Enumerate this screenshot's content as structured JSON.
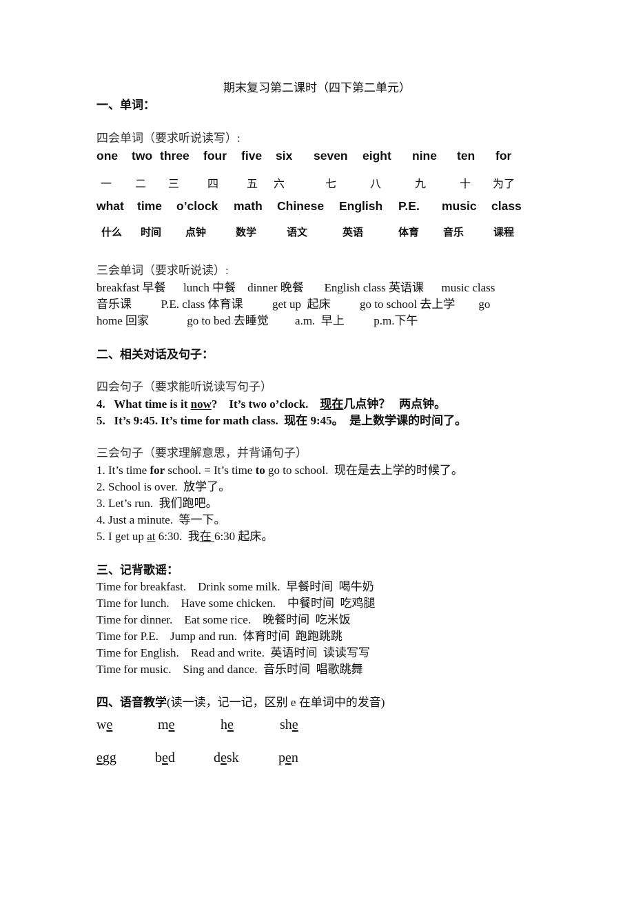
{
  "title": "期末复习第二课时（四下第二单元）",
  "section1": {
    "heading": "一、单词：",
    "four_skill_words": {
      "label": "四会单词（要求听说读写）:",
      "row1_en": [
        "one",
        "two",
        "three",
        "four",
        "five",
        "six",
        "seven",
        "eight",
        "nine",
        "ten",
        "for"
      ],
      "row1_zh": [
        "一",
        "二",
        "三",
        "四",
        "五",
        "六",
        "七",
        "八",
        "九",
        "十",
        "为了"
      ],
      "row2_en": [
        "what",
        "time",
        "o’clock",
        "math",
        "Chinese",
        "English",
        "P.E.",
        "music",
        "class"
      ],
      "row2_zh": [
        "什么",
        "时间",
        "点钟",
        "数学",
        "语文",
        "英语",
        "体育",
        "音乐",
        "课程"
      ]
    },
    "three_skill_words": {
      "label": "三会单词（要求听说读）:",
      "lines": [
        "breakfast 早餐      lunch 中餐    dinner 晚餐       English class 英语课      music class",
        "音乐课          P.E. class 体育课          get up  起床          go to school 去上学        go",
        "home 回家             go to bed 去睡觉         a.m.  早上          p.m.下午"
      ]
    }
  },
  "section2": {
    "heading": "二、相关对话及句子：",
    "four_skill_sentences": {
      "label": "四会句子（要求能听说读写句子）",
      "s4": {
        "num": "4.",
        "pre": "What time is it ",
        "ul": "now",
        "post": "?    It’s two o’clock.    ",
        "zh_ul": "现在",
        "zh_post": "几点钟？   两点钟。"
      },
      "s5": {
        "num": "5.",
        "text": "It’s 9:45. It’s time for math class.  现在 9:45。  是上数学课的时间了。"
      }
    },
    "three_skill_sentences": {
      "label": "三会句子（要求理解意思，并背诵句子）",
      "s1": {
        "a": "1. It’s time ",
        "b": "for",
        "c": " school. = It’s time ",
        "d": "to",
        "e": " go to school.  现在是去上学的时候了。"
      },
      "s2": "2. School is over.  放学了。",
      "s3": "3. Let’s run.  我们跑吧。",
      "s4": "4. Just a minute.  等一下。",
      "s5": {
        "a": "5. I get up ",
        "ul1": "at",
        "b": " 6:30.  我",
        "ul2": "在 ",
        "c": "6:30 起床。"
      }
    }
  },
  "section3": {
    "heading": "三、记背歌谣：",
    "lines": [
      "Time for breakfast.    Drink some milk.  早餐时间  喝牛奶",
      "Time for lunch.    Have some chicken.    中餐时间  吃鸡腿",
      "Time for dinner.    Eat some rice.    晚餐时间  吃米饭",
      "Time for P.E.    Jump and run.  体育时间  跑跑跳跳",
      "Time for English.    Read and write.  英语时间  读读写写",
      "Time for music.    Sing and dance.  音乐时间  唱歌跳舞"
    ]
  },
  "section4": {
    "heading": "四、语音教学",
    "note": "(读一读，记一记，区别 e 在单词中的发音)",
    "row1": [
      {
        "pre": "w",
        "ul": "e",
        "post": ""
      },
      {
        "pre": "m",
        "ul": "e",
        "post": ""
      },
      {
        "pre": "h",
        "ul": "e",
        "post": ""
      },
      {
        "pre": "sh",
        "ul": "e",
        "post": ""
      }
    ],
    "row2": [
      {
        "pre": "",
        "ul": "e",
        "post": "gg"
      },
      {
        "pre": "b",
        "ul": "e",
        "post": "d"
      },
      {
        "pre": "d",
        "ul": "e",
        "post": "sk"
      },
      {
        "pre": "p",
        "ul": "e",
        "post": "n"
      }
    ]
  }
}
